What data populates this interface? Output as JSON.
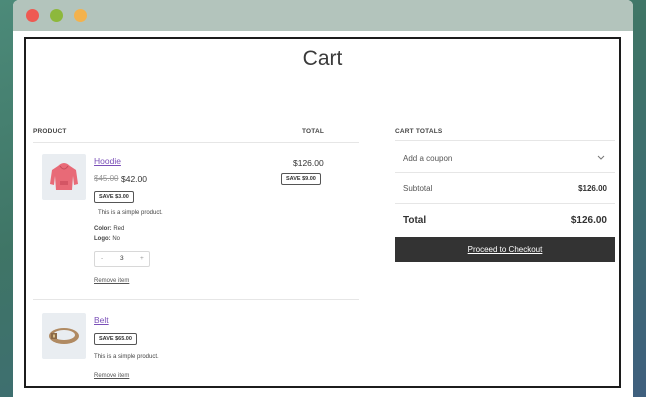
{
  "page": {
    "title": "Cart"
  },
  "table": {
    "col_product": "PRODUCT",
    "col_total": "TOTAL"
  },
  "items": [
    {
      "name": "Hoodie",
      "old_price": "$45.00",
      "price": "$42.00",
      "save_badge": "SAVE $3.00",
      "description": "This is a simple product.",
      "color_label": "Color:",
      "color_value": "Red",
      "logo_label": "Logo:",
      "logo_value": "No",
      "qty_minus": "-",
      "quantity": "3",
      "qty_plus": "+",
      "remove_label": "Remove item",
      "line_total": "$126.00",
      "line_save_badge": "SAVE $9.00",
      "thumb_icon": "hoodie-icon"
    },
    {
      "name": "Belt",
      "save_badge": "SAVE $65.00",
      "description": "This is a simple product.",
      "remove_label": "Remove item",
      "thumb_icon": "belt-icon"
    }
  ],
  "totals": {
    "heading": "CART TOTALS",
    "coupon_label": "Add a coupon",
    "subtotal_label": "Subtotal",
    "subtotal_value": "$126.00",
    "total_label": "Total",
    "total_value": "$126.00",
    "checkout_label": "Proceed to Checkout"
  },
  "colors": {
    "window_bar": "#b3c4bc",
    "close": "#ee5a52",
    "minimize": "#8db83c",
    "maximize": "#f3b24d",
    "link": "#7a4fb8",
    "checkout_button": "#333333"
  }
}
